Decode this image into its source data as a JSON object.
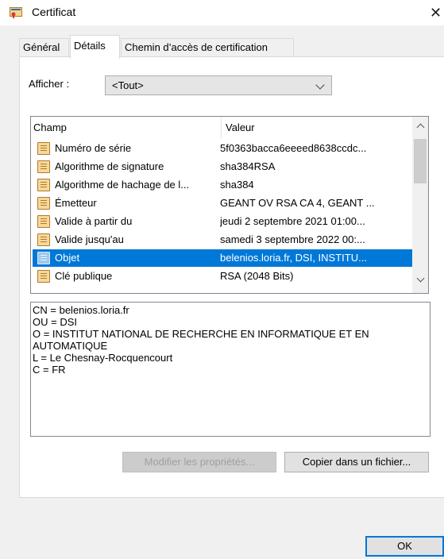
{
  "window": {
    "title": "Certificat",
    "close_glyph": "✕"
  },
  "tabs": [
    {
      "label": "Général",
      "active": false
    },
    {
      "label": "Détails",
      "active": true
    },
    {
      "label": "Chemin d’accès de certification",
      "active": false
    }
  ],
  "show": {
    "label": "Afficher :",
    "selected": "<Tout>"
  },
  "list": {
    "columns": [
      "Champ",
      "Valeur"
    ],
    "rows": [
      {
        "field": "Numéro de série",
        "value": "5f0363bacca6eeeed8638ccdc...",
        "icon": "document-icon"
      },
      {
        "field": "Algorithme de signature",
        "value": "sha384RSA",
        "icon": "document-icon"
      },
      {
        "field": "Algorithme de hachage de l...",
        "value": "sha384",
        "icon": "document-icon"
      },
      {
        "field": "Émetteur",
        "value": "GEANT OV RSA CA 4, GEANT ...",
        "icon": "document-icon"
      },
      {
        "field": "Valide à partir du",
        "value": "jeudi 2 septembre 2021 01:00...",
        "icon": "document-icon"
      },
      {
        "field": "Valide jusqu'au",
        "value": "samedi 3 septembre 2022 00:...",
        "icon": "document-icon"
      },
      {
        "field": "Objet",
        "value": "belenios.loria.fr, DSI, INSTITU...",
        "icon": "document-icon",
        "selected": true
      },
      {
        "field": "Clé publique",
        "value": "RSA (2048 Bits)",
        "icon": "document-icon"
      }
    ]
  },
  "detail_lines": [
    "CN = belenios.loria.fr",
    "OU = DSI",
    "O = INSTITUT NATIONAL DE RECHERCHE EN INFORMATIQUE ET EN",
    "AUTOMATIQUE",
    "L = Le Chesnay-Rocquencourt",
    "C = FR"
  ],
  "buttons": {
    "edit_properties": "Modifier les propriétés...",
    "copy_to_file": "Copier dans un fichier...",
    "ok": "OK"
  },
  "colors": {
    "selection": "#0078d7",
    "panel": "#ffffff",
    "background": "#f0f0f0"
  }
}
